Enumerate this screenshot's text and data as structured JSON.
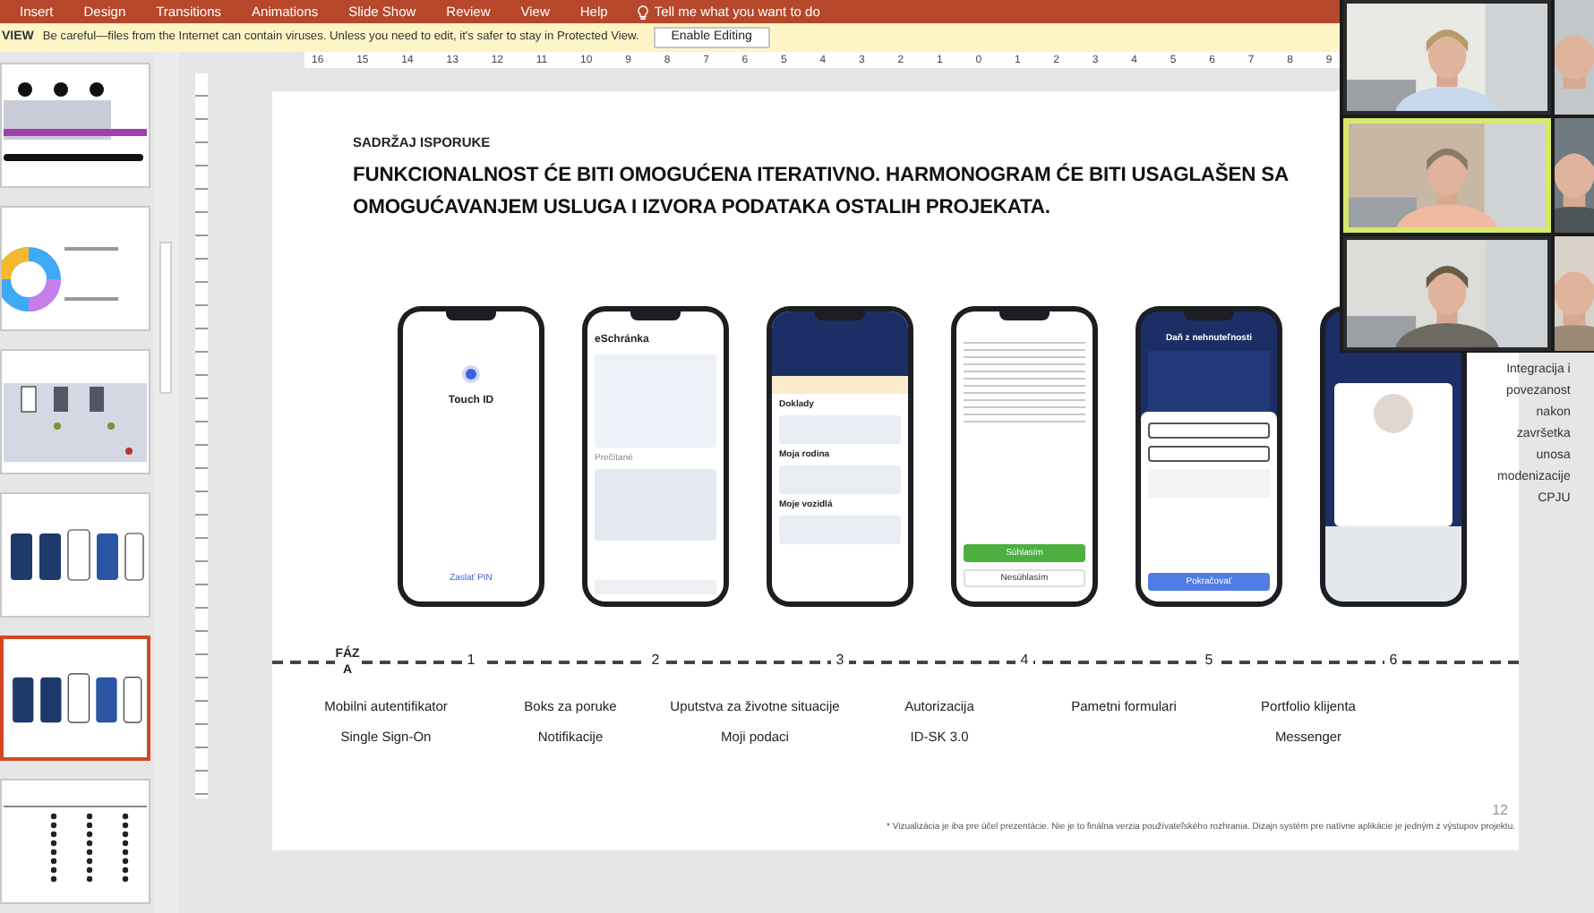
{
  "ribbon": {
    "tabs": [
      "Insert",
      "Design",
      "Transitions",
      "Animations",
      "Slide Show",
      "Review",
      "View",
      "Help"
    ],
    "tell_me": "Tell me what you want to do"
  },
  "protected_view": {
    "label": "VIEW",
    "message": "Be careful—files from the Internet can contain viruses. Unless you need to edit, it's safer to stay in Protected View.",
    "button": "Enable Editing"
  },
  "ruler": [
    "16",
    "15",
    "14",
    "13",
    "12",
    "11",
    "10",
    "9",
    "8",
    "7",
    "6",
    "5",
    "4",
    "3",
    "2",
    "1",
    "0",
    "1",
    "2",
    "3",
    "4",
    "5",
    "6",
    "7",
    "8",
    "9"
  ],
  "thumbnails": [
    {
      "kind": "timeline",
      "selected": false
    },
    {
      "kind": "donut",
      "selected": false
    },
    {
      "kind": "flow",
      "selected": false
    },
    {
      "kind": "phones",
      "selected": false
    },
    {
      "kind": "phones",
      "selected": true
    },
    {
      "kind": "table",
      "selected": false
    }
  ],
  "slide": {
    "eyebrow": "SADRŽAJ ISPORUKE",
    "title": "FUNKCIONALNOST ĆE BITI OMOGUĆENA ITERATIVNO. HARMONOGRAM ĆE BITI USAGLAŠEN SA OMOGUĆAVANJEM USLUGA I IZVORA PODATAKA OSTALIH PROJEKATA.",
    "phones": [
      {
        "kind": "touch-id",
        "title": "Touch ID",
        "link": "Zaslať PIN"
      },
      {
        "kind": "inbox",
        "title": "eSchránka",
        "section": "Prečítané"
      },
      {
        "kind": "wallet",
        "sections": [
          "Doklady",
          "Moja rodina",
          "Moje vozidlá"
        ]
      },
      {
        "kind": "document",
        "primary": "Súhlasím",
        "secondary": "Nesúhlasím"
      },
      {
        "kind": "form",
        "title": "Daň z nehnuteľnosti",
        "button": "Pokračovať"
      },
      {
        "kind": "profile"
      }
    ],
    "phase_label": "FÁZA",
    "phases": [
      {
        "number": "1",
        "lines": [
          "Mobilni autentifikator",
          "Single Sign-On"
        ]
      },
      {
        "number": "2",
        "lines": [
          "Boks za poruke",
          "Notifikacije"
        ]
      },
      {
        "number": "3",
        "lines": [
          "Uputstva za životne situacije",
          "Moji podaci"
        ]
      },
      {
        "number": "4",
        "lines": [
          "Autorizacija",
          "ID-SK 3.0"
        ]
      },
      {
        "number": "5",
        "lines": [
          "Pametni formulari"
        ]
      },
      {
        "number": "6",
        "lines": [
          "Portfolio klijenta",
          "Messenger"
        ]
      }
    ],
    "side_note": [
      "Integracija i",
      "povezanost",
      "nakon",
      "završetka",
      "unosa",
      "modenizacije",
      "CPJU"
    ],
    "footnote": "* Vizualizácia je iba pre účel prezentácie. Nie je to finálna verzia používateľského rozhrania. Dizajn systém pre natívne aplikácie je jedným z výstupov projektu.",
    "page_number": "12"
  },
  "video_call": {
    "tiles": [
      {
        "kind": "picture",
        "speaking": false
      },
      {
        "kind": "picture",
        "speaking": true
      },
      {
        "kind": "picture",
        "speaking": false
      }
    ]
  }
}
